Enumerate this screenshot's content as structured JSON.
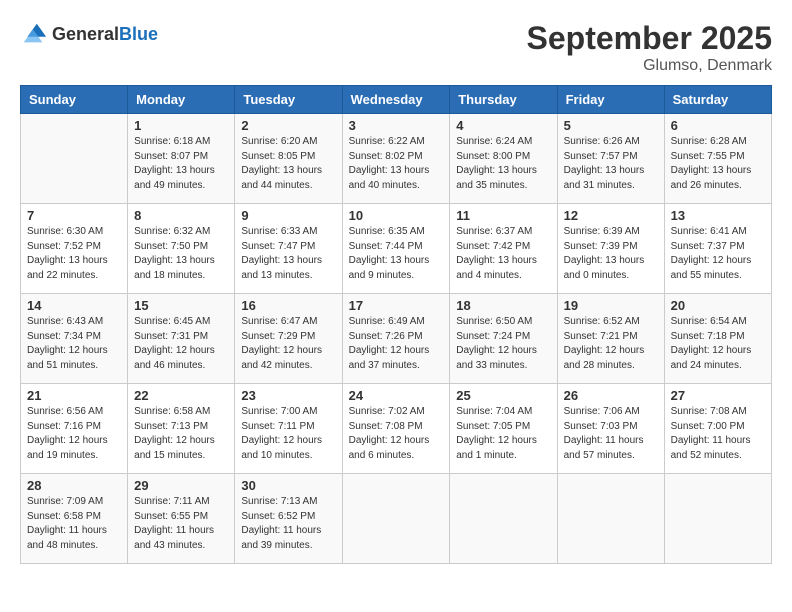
{
  "logo": {
    "general": "General",
    "blue": "Blue"
  },
  "header": {
    "month": "September 2025",
    "location": "Glumso, Denmark"
  },
  "days_of_week": [
    "Sunday",
    "Monday",
    "Tuesday",
    "Wednesday",
    "Thursday",
    "Friday",
    "Saturday"
  ],
  "weeks": [
    [
      {
        "num": "",
        "sunrise": "",
        "sunset": "",
        "daylight": ""
      },
      {
        "num": "1",
        "sunrise": "Sunrise: 6:18 AM",
        "sunset": "Sunset: 8:07 PM",
        "daylight": "Daylight: 13 hours and 49 minutes."
      },
      {
        "num": "2",
        "sunrise": "Sunrise: 6:20 AM",
        "sunset": "Sunset: 8:05 PM",
        "daylight": "Daylight: 13 hours and 44 minutes."
      },
      {
        "num": "3",
        "sunrise": "Sunrise: 6:22 AM",
        "sunset": "Sunset: 8:02 PM",
        "daylight": "Daylight: 13 hours and 40 minutes."
      },
      {
        "num": "4",
        "sunrise": "Sunrise: 6:24 AM",
        "sunset": "Sunset: 8:00 PM",
        "daylight": "Daylight: 13 hours and 35 minutes."
      },
      {
        "num": "5",
        "sunrise": "Sunrise: 6:26 AM",
        "sunset": "Sunset: 7:57 PM",
        "daylight": "Daylight: 13 hours and 31 minutes."
      },
      {
        "num": "6",
        "sunrise": "Sunrise: 6:28 AM",
        "sunset": "Sunset: 7:55 PM",
        "daylight": "Daylight: 13 hours and 26 minutes."
      }
    ],
    [
      {
        "num": "7",
        "sunrise": "Sunrise: 6:30 AM",
        "sunset": "Sunset: 7:52 PM",
        "daylight": "Daylight: 13 hours and 22 minutes."
      },
      {
        "num": "8",
        "sunrise": "Sunrise: 6:32 AM",
        "sunset": "Sunset: 7:50 PM",
        "daylight": "Daylight: 13 hours and 18 minutes."
      },
      {
        "num": "9",
        "sunrise": "Sunrise: 6:33 AM",
        "sunset": "Sunset: 7:47 PM",
        "daylight": "Daylight: 13 hours and 13 minutes."
      },
      {
        "num": "10",
        "sunrise": "Sunrise: 6:35 AM",
        "sunset": "Sunset: 7:44 PM",
        "daylight": "Daylight: 13 hours and 9 minutes."
      },
      {
        "num": "11",
        "sunrise": "Sunrise: 6:37 AM",
        "sunset": "Sunset: 7:42 PM",
        "daylight": "Daylight: 13 hours and 4 minutes."
      },
      {
        "num": "12",
        "sunrise": "Sunrise: 6:39 AM",
        "sunset": "Sunset: 7:39 PM",
        "daylight": "Daylight: 13 hours and 0 minutes."
      },
      {
        "num": "13",
        "sunrise": "Sunrise: 6:41 AM",
        "sunset": "Sunset: 7:37 PM",
        "daylight": "Daylight: 12 hours and 55 minutes."
      }
    ],
    [
      {
        "num": "14",
        "sunrise": "Sunrise: 6:43 AM",
        "sunset": "Sunset: 7:34 PM",
        "daylight": "Daylight: 12 hours and 51 minutes."
      },
      {
        "num": "15",
        "sunrise": "Sunrise: 6:45 AM",
        "sunset": "Sunset: 7:31 PM",
        "daylight": "Daylight: 12 hours and 46 minutes."
      },
      {
        "num": "16",
        "sunrise": "Sunrise: 6:47 AM",
        "sunset": "Sunset: 7:29 PM",
        "daylight": "Daylight: 12 hours and 42 minutes."
      },
      {
        "num": "17",
        "sunrise": "Sunrise: 6:49 AM",
        "sunset": "Sunset: 7:26 PM",
        "daylight": "Daylight: 12 hours and 37 minutes."
      },
      {
        "num": "18",
        "sunrise": "Sunrise: 6:50 AM",
        "sunset": "Sunset: 7:24 PM",
        "daylight": "Daylight: 12 hours and 33 minutes."
      },
      {
        "num": "19",
        "sunrise": "Sunrise: 6:52 AM",
        "sunset": "Sunset: 7:21 PM",
        "daylight": "Daylight: 12 hours and 28 minutes."
      },
      {
        "num": "20",
        "sunrise": "Sunrise: 6:54 AM",
        "sunset": "Sunset: 7:18 PM",
        "daylight": "Daylight: 12 hours and 24 minutes."
      }
    ],
    [
      {
        "num": "21",
        "sunrise": "Sunrise: 6:56 AM",
        "sunset": "Sunset: 7:16 PM",
        "daylight": "Daylight: 12 hours and 19 minutes."
      },
      {
        "num": "22",
        "sunrise": "Sunrise: 6:58 AM",
        "sunset": "Sunset: 7:13 PM",
        "daylight": "Daylight: 12 hours and 15 minutes."
      },
      {
        "num": "23",
        "sunrise": "Sunrise: 7:00 AM",
        "sunset": "Sunset: 7:11 PM",
        "daylight": "Daylight: 12 hours and 10 minutes."
      },
      {
        "num": "24",
        "sunrise": "Sunrise: 7:02 AM",
        "sunset": "Sunset: 7:08 PM",
        "daylight": "Daylight: 12 hours and 6 minutes."
      },
      {
        "num": "25",
        "sunrise": "Sunrise: 7:04 AM",
        "sunset": "Sunset: 7:05 PM",
        "daylight": "Daylight: 12 hours and 1 minute."
      },
      {
        "num": "26",
        "sunrise": "Sunrise: 7:06 AM",
        "sunset": "Sunset: 7:03 PM",
        "daylight": "Daylight: 11 hours and 57 minutes."
      },
      {
        "num": "27",
        "sunrise": "Sunrise: 7:08 AM",
        "sunset": "Sunset: 7:00 PM",
        "daylight": "Daylight: 11 hours and 52 minutes."
      }
    ],
    [
      {
        "num": "28",
        "sunrise": "Sunrise: 7:09 AM",
        "sunset": "Sunset: 6:58 PM",
        "daylight": "Daylight: 11 hours and 48 minutes."
      },
      {
        "num": "29",
        "sunrise": "Sunrise: 7:11 AM",
        "sunset": "Sunset: 6:55 PM",
        "daylight": "Daylight: 11 hours and 43 minutes."
      },
      {
        "num": "30",
        "sunrise": "Sunrise: 7:13 AM",
        "sunset": "Sunset: 6:52 PM",
        "daylight": "Daylight: 11 hours and 39 minutes."
      },
      {
        "num": "",
        "sunrise": "",
        "sunset": "",
        "daylight": ""
      },
      {
        "num": "",
        "sunrise": "",
        "sunset": "",
        "daylight": ""
      },
      {
        "num": "",
        "sunrise": "",
        "sunset": "",
        "daylight": ""
      },
      {
        "num": "",
        "sunrise": "",
        "sunset": "",
        "daylight": ""
      }
    ]
  ]
}
